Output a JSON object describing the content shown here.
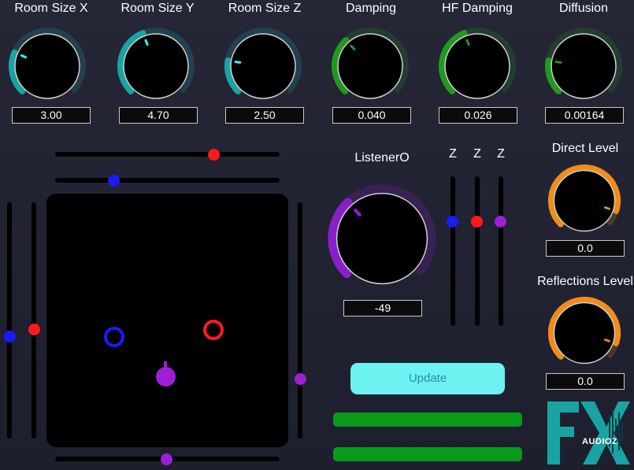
{
  "knobs_top": [
    {
      "label": "Room Size X",
      "value": "3.00",
      "color": "#1aa3a3",
      "icon": "knob-teal",
      "level": 0.25
    },
    {
      "label": "Room Size Y",
      "value": "4.70",
      "color": "#1aa3a3",
      "icon": "knob-teal",
      "level": 0.42
    },
    {
      "label": "Room Size Z",
      "value": "2.50",
      "color": "#1aa3a3",
      "icon": "knob-teal",
      "level": 0.2
    },
    {
      "label": "Damping",
      "value": "0.040",
      "color": "#1f9a1f",
      "icon": "knob-green",
      "level": 0.34
    },
    {
      "label": "HF Damping",
      "value": "0.026",
      "color": "#1f9a1f",
      "icon": "knob-green",
      "level": 0.42
    },
    {
      "label": "Diffusion",
      "value": "0.00164",
      "color": "#1f9a1f",
      "icon": "knob-green",
      "level": 0.2
    }
  ],
  "listener": {
    "label": "ListenerO",
    "value": "-49",
    "color": "#8a1fc9",
    "level": 0.34
  },
  "z_sliders": {
    "labels": [
      "Z",
      "Z",
      "Z"
    ],
    "colors": [
      "#1a1aff",
      "#ff1a1a",
      "#9d1fd6"
    ]
  },
  "direct_level": {
    "label": "Direct Level",
    "value": "0.0",
    "color": "#f08c1a",
    "level": 0.9
  },
  "reflections_level": {
    "label": "Reflections Level",
    "value": "0.0",
    "color": "#f08c1a",
    "level": 0.9
  },
  "update_button": {
    "label": "Update"
  },
  "pad": {
    "sources": [
      "red-ring",
      "blue-ring",
      "purple-source"
    ]
  },
  "logo": {
    "text": "FX",
    "watermark": "AUDIOZ"
  },
  "colors": {
    "teal": "#1aa3a3",
    "green": "#1f9a1f",
    "purple": "#8a1fc9",
    "orange": "#f08c1a",
    "red": "#ff1a1a",
    "blue": "#1a1aff",
    "button": "#6df2f2"
  }
}
